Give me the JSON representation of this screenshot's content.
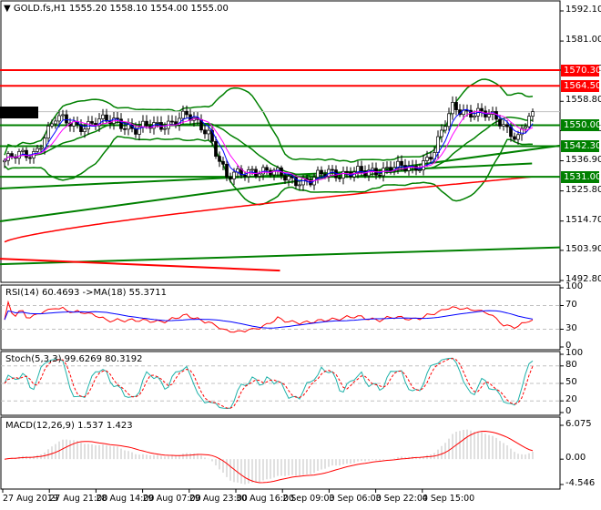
{
  "header": {
    "symbol": "GOLD.fs,H1",
    "ohlc": "1555.20 1558.10 1554.00 1555.00"
  },
  "price_axis": {
    "ticks": [
      "1592.10",
      "1581.00",
      "1570.30",
      "1558.80",
      "1548.00",
      "1536.90",
      "1525.80",
      "1514.70",
      "1503.90",
      "1492.80"
    ],
    "range": [
      1492.8,
      1592.1
    ],
    "levels": [
      {
        "label": "1570.30",
        "value": 1570.3,
        "color": "#ff0000"
      },
      {
        "label": "1564.50",
        "value": 1564.5,
        "color": "#ff0000"
      },
      {
        "label": "1550.00",
        "value": 1550.0,
        "color": "#008000"
      },
      {
        "label": "1542.30",
        "value": 1542.3,
        "color": "#008000"
      },
      {
        "label": "1531.00",
        "value": 1531.0,
        "color": "#008000"
      }
    ],
    "current": {
      "label": "1555.00",
      "value": 1555.0
    }
  },
  "trendlines": [
    {
      "from": 1514.6,
      "to": 1542.5,
      "color": "#008000"
    },
    {
      "from": 1526.7,
      "to": 1536.4,
      "color": "#008000",
      "end": 0.95
    },
    {
      "from": 1498.8,
      "to": 1505.0,
      "color": "#008000"
    },
    {
      "from": 1500.8,
      "to": 1492.1,
      "color": "#ff0000",
      "end": 0.5
    }
  ],
  "price_path": [
    [
      0,
      1537
    ],
    [
      8,
      1540
    ],
    [
      14,
      1552
    ],
    [
      22,
      1550
    ],
    [
      31,
      1552
    ],
    [
      36,
      1548
    ],
    [
      50,
      1553
    ],
    [
      56,
      1548
    ],
    [
      61,
      1530
    ],
    [
      68,
      1534
    ],
    [
      74,
      1532
    ],
    [
      84,
      1529
    ],
    [
      89,
      1533
    ],
    [
      99,
      1532
    ],
    [
      106,
      1535
    ],
    [
      112,
      1533
    ],
    [
      118,
      1541
    ],
    [
      123,
      1556
    ],
    [
      130,
      1555
    ],
    [
      136,
      1551
    ],
    [
      141,
      1546
    ],
    [
      145,
      1555
    ]
  ],
  "rsi": {
    "title": "RSI(14) 60.4693  ->MA(18) 55.3711",
    "ticks": [
      "100",
      "70",
      "30",
      "0"
    ]
  },
  "stoch": {
    "title": "Stoch(5,3,3) 99.6269 80.3192",
    "ticks": [
      "100",
      "80",
      "50",
      "20",
      "0"
    ]
  },
  "macd": {
    "title": "MACD(12,26,9) 1.537 1.423",
    "ticks": [
      "6.075",
      "0.00",
      "-4.546"
    ],
    "range": [
      -4.546,
      6.075
    ]
  },
  "time_axis": [
    "27 Aug 2019",
    "27 Aug 21:00",
    "28 Aug 14:00",
    "29 Aug 07:00",
    "29 Aug 23:00",
    "30 Aug 16:00",
    "2 Sep 09:00",
    "3 Sep 06:00",
    "3 Sep 22:00",
    "4 Sep 15:00"
  ]
}
